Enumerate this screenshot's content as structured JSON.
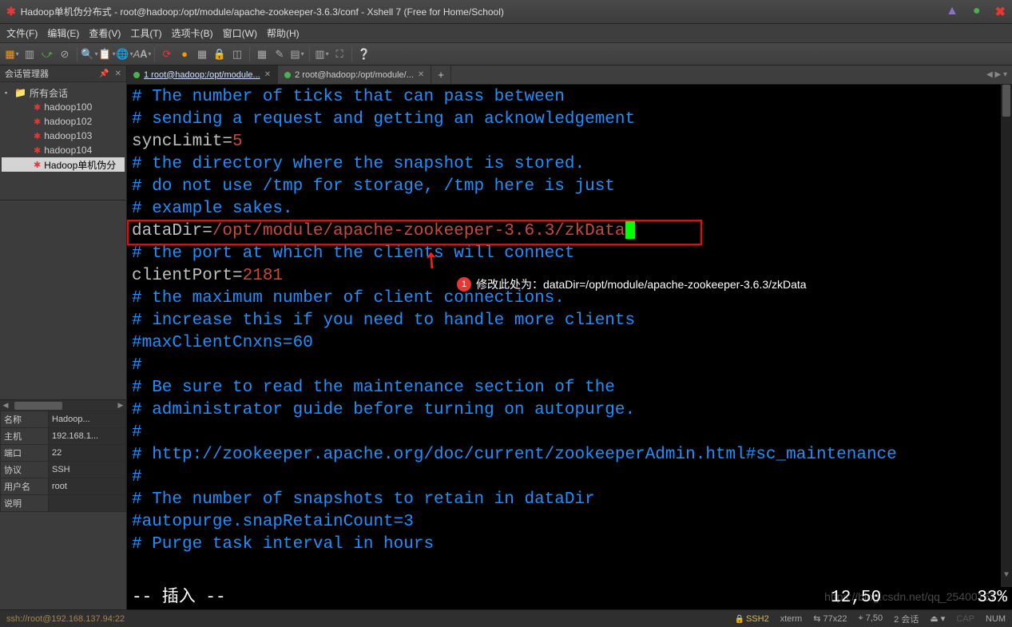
{
  "title": "Hadoop单机伪分布式 - root@hadoop:/opt/module/apache-zookeeper-3.6.3/conf - Xshell 7 (Free for Home/School)",
  "menubar": [
    "文件(F)",
    "编辑(E)",
    "查看(V)",
    "工具(T)",
    "选项卡(B)",
    "窗口(W)",
    "帮助(H)"
  ],
  "session_panel": {
    "title": "会话管理器",
    "root": "所有会话",
    "items": [
      "hadoop100",
      "hadoop102",
      "hadoop103",
      "hadoop104",
      "Hadoop单机伪分"
    ]
  },
  "properties": {
    "rows": [
      [
        "名称",
        "Hadoop..."
      ],
      [
        "主机",
        "192.168.1..."
      ],
      [
        "端口",
        "22"
      ],
      [
        "协议",
        "SSH"
      ],
      [
        "用户名",
        "root"
      ],
      [
        "说明",
        ""
      ]
    ]
  },
  "tabs": [
    {
      "label": "1 root@hadoop:/opt/module...",
      "active": true
    },
    {
      "label": "2 root@hadoop:/opt/module/...",
      "active": false
    }
  ],
  "terminal": {
    "lines": [
      {
        "t": "c",
        "txt": "# The number of ticks that can pass between"
      },
      {
        "t": "c",
        "txt": "# sending a request and getting an acknowledgement"
      },
      {
        "t": "kv",
        "k": "syncLimit=",
        "v": "5"
      },
      {
        "t": "c",
        "txt": "# the directory where the snapshot is stored."
      },
      {
        "t": "c",
        "txt": "# do not use /tmp for storage, /tmp here is just"
      },
      {
        "t": "c",
        "txt": "# example sakes."
      },
      {
        "t": "kv",
        "k": "dataDir=",
        "v": "/opt/module/apache-zookeeper-3.6.3/zkData",
        "cursor": true,
        "boxed": true
      },
      {
        "t": "c",
        "txt": "# the port at which the clients will connect"
      },
      {
        "t": "kv",
        "k": "clientPort=",
        "v": "2181"
      },
      {
        "t": "c",
        "txt": "# the maximum number of client connections."
      },
      {
        "t": "c",
        "txt": "# increase this if you need to handle more clients"
      },
      {
        "t": "c",
        "txt": "#maxClientCnxns=60"
      },
      {
        "t": "c",
        "txt": "#"
      },
      {
        "t": "c",
        "txt": "# Be sure to read the maintenance section of the"
      },
      {
        "t": "c",
        "txt": "# administrator guide before turning on autopurge."
      },
      {
        "t": "c",
        "txt": "#"
      },
      {
        "t": "c",
        "txt": "# http://zookeeper.apache.org/doc/current/zookeeperAdmin.html#sc_maintenance"
      },
      {
        "t": "c",
        "txt": "#"
      },
      {
        "t": "c",
        "txt": "# The number of snapshots to retain in dataDir"
      },
      {
        "t": "c",
        "txt": "#autopurge.snapRetainCount=3"
      },
      {
        "t": "c",
        "txt": "# Purge task interval in hours"
      }
    ],
    "mode": "-- 插入 --",
    "position": "12,50",
    "percent": "33%"
  },
  "annotation": {
    "number": "1",
    "text": "修改此处为：dataDir=/opt/module/apache-zookeeper-3.6.3/zkData"
  },
  "statusbar": {
    "left": "ssh://root@192.168.137.94:22",
    "ssh": "SSH2",
    "term": "xterm",
    "size": "77x22",
    "caret": "7,50",
    "sessions": "2 会话",
    "cap": "CAP",
    "num": "NUM"
  },
  "watermark": "https://blog.csdn.net/qq_25400167"
}
